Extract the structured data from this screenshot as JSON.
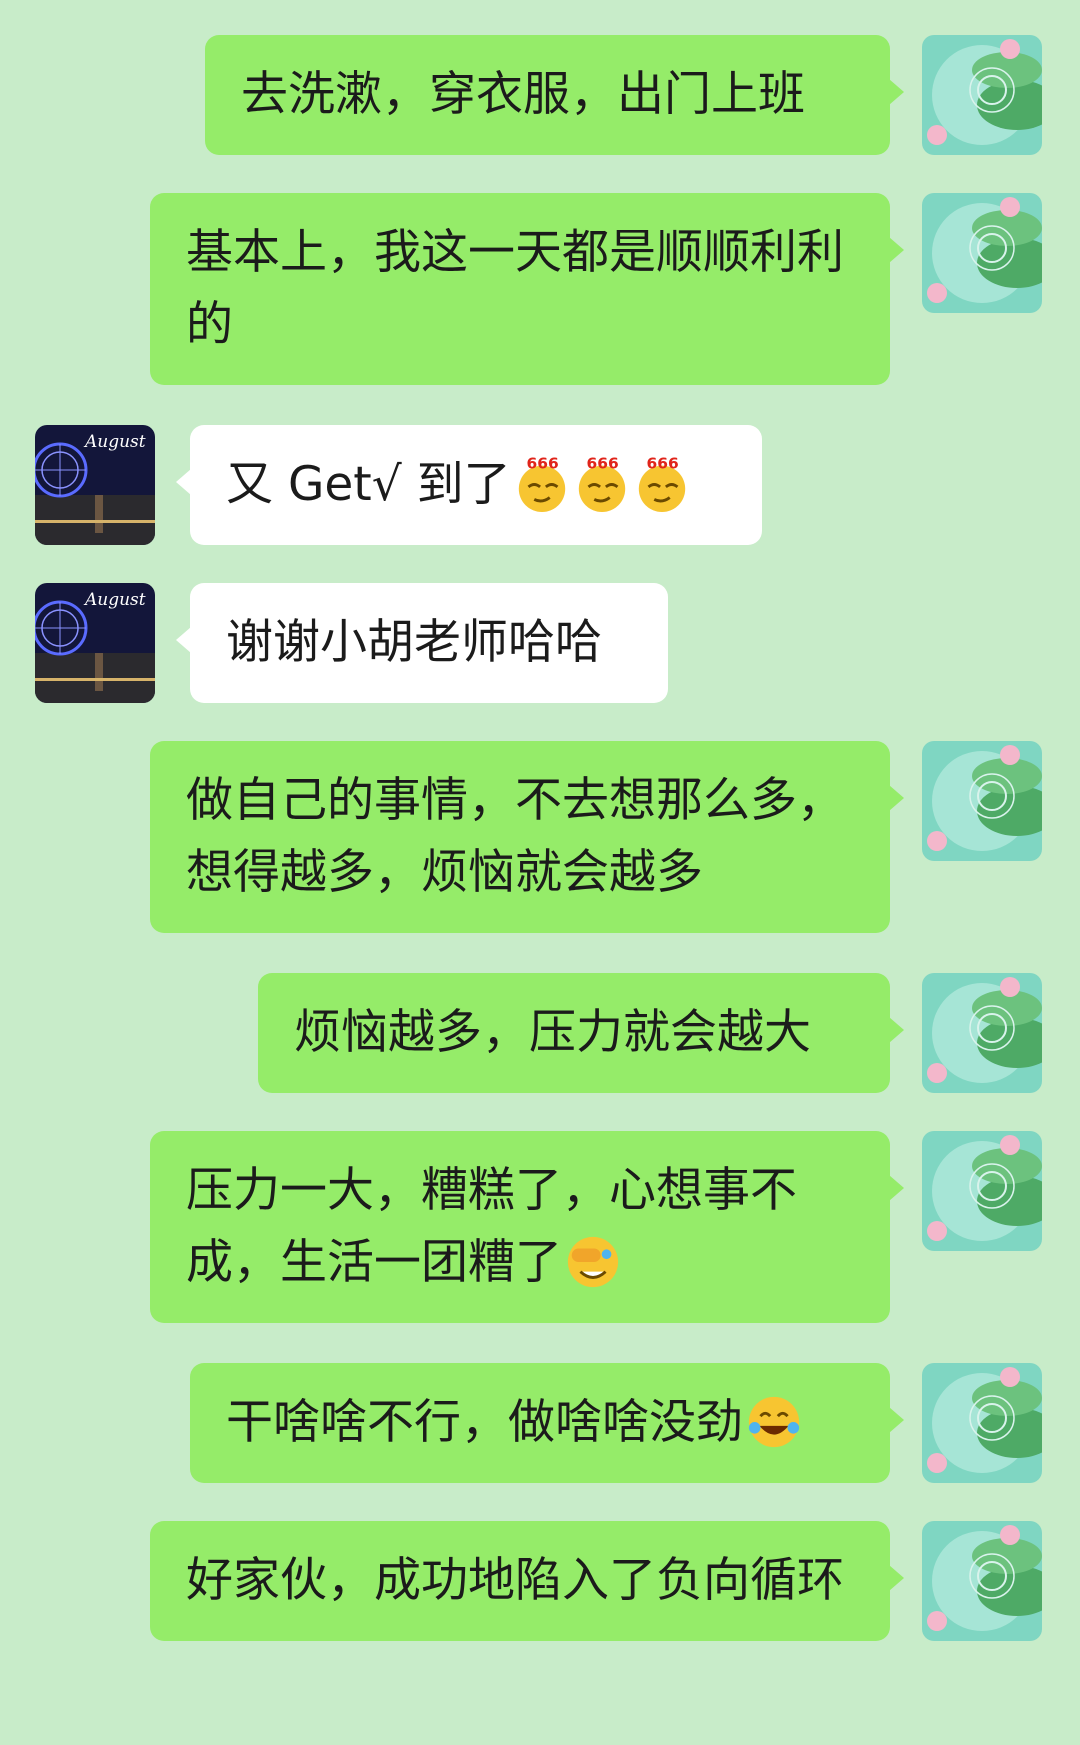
{
  "messages": [
    {
      "side": "self",
      "text": "去洗漱，穿衣服，出门上班",
      "emoji": []
    },
    {
      "side": "self",
      "text": "基本上，我这一天都是顺顺利利的",
      "emoji": []
    },
    {
      "side": "other",
      "text": "又 Get√ 到了",
      "emoji": [
        "666-smug-emoji",
        "666-smug-emoji",
        "666-smug-emoji"
      ]
    },
    {
      "side": "other",
      "text": "谢谢小胡老师哈哈",
      "emoji": []
    },
    {
      "side": "self",
      "text": "做自己的事情，不去想那么多，想得越多，烦恼就会越多",
      "emoji": []
    },
    {
      "side": "self",
      "text": "烦恼越多，压力就会越大",
      "emoji": []
    },
    {
      "side": "self",
      "text": "压力一大，糟糕了，心想事不成，生活一团糟了",
      "emoji": [
        "facepalm-laugh-emoji"
      ]
    },
    {
      "side": "self",
      "text": "干啥啥不行，做啥啥没劲",
      "emoji": [
        "tears-of-joy-emoji"
      ]
    },
    {
      "side": "self",
      "text": "好家伙，成功地陷入了负向循环",
      "emoji": []
    }
  ],
  "avatars": {
    "self": {
      "icon": "lotus-pond-avatar"
    },
    "other": {
      "icon": "ferris-wheel-night-avatar",
      "label": "August"
    }
  },
  "emoji_badge": "666",
  "colors": {
    "background": "#c8ecc9",
    "self_bubble": "#95ec69",
    "other_bubble": "#ffffff"
  }
}
